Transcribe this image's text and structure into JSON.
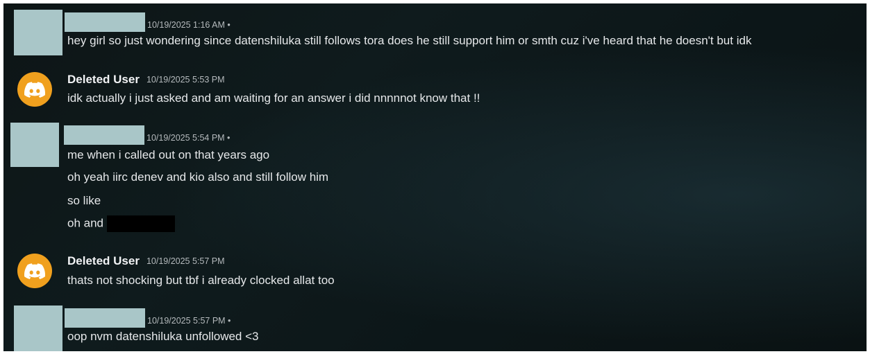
{
  "messages": [
    {
      "author": "",
      "avatar": "redacted",
      "timestamp": "10/19/2025 1:16 AM •",
      "lines": [
        "hey girl so just wondering since datenshiluka still follows tora does he still support him or smth cuz i've heard that he doesn't but idk"
      ]
    },
    {
      "author": "Deleted User",
      "avatar": "discord-logo-icon",
      "timestamp": "10/19/2025 5:53 PM",
      "lines": [
        "idk actually i just asked and am waiting for an answer i did nnnnnot know that !!"
      ]
    },
    {
      "author": "",
      "avatar": "redacted",
      "timestamp": "10/19/2025 5:54 PM •",
      "lines": [
        "me when i called out on that years ago",
        "oh yeah iirc denev and kio also and still follow him",
        "so like",
        "oh and"
      ]
    },
    {
      "author": "Deleted User",
      "avatar": "discord-logo-icon",
      "timestamp": "10/19/2025 5:57 PM",
      "lines": [
        "thats not shocking but tbf i already clocked allat too"
      ]
    },
    {
      "author": "",
      "avatar": "redacted",
      "timestamp": "10/19/2025 5:57 PM •",
      "lines": [
        "oop nvm datenshiluka unfollowed <3"
      ]
    }
  ],
  "colors": {
    "background": "#0f1b1d",
    "redaction_tint": "#a9c6c8",
    "discord_avatar": "#f0a01e",
    "text": "#e6e8ea",
    "timestamp": "#b5babd"
  }
}
